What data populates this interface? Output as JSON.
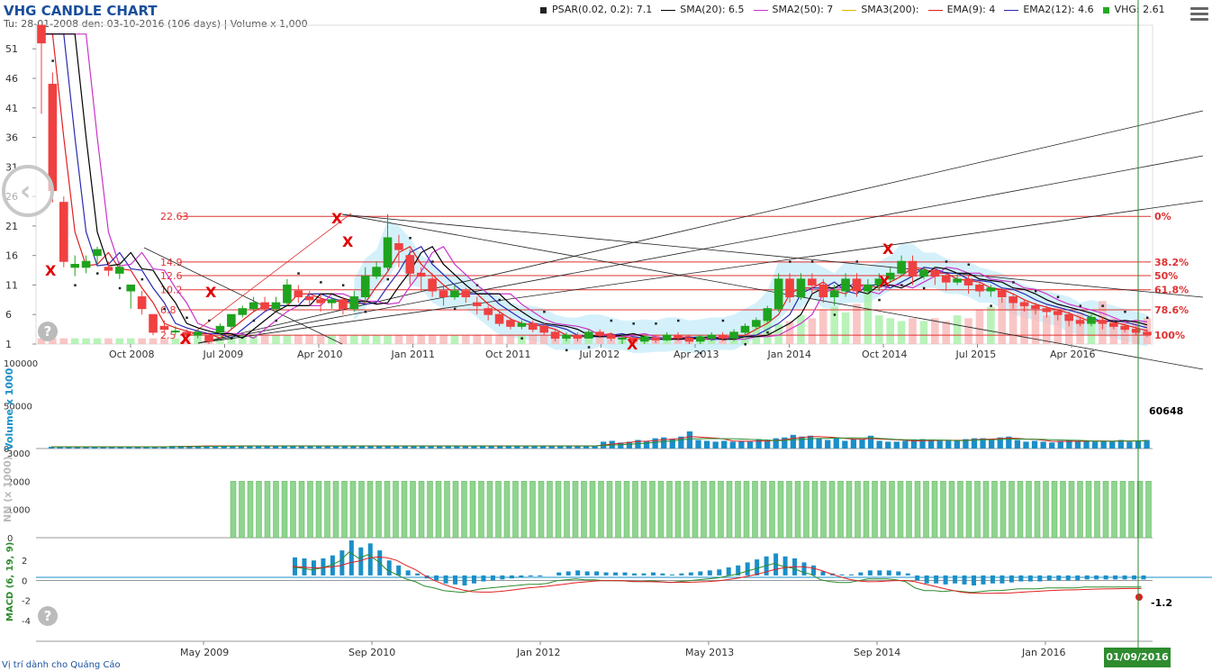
{
  "title": "VHG CANDLE CHART",
  "subtitle": "Tu: 28-01-2008 den: 03-10-2016 (106 days) | Volume x 1,000",
  "legend": [
    {
      "label": "PSAR(0.02, 0.2): 7.1",
      "color": "#222222",
      "kind": "square"
    },
    {
      "label": "SMA(20): 6.5",
      "color": "#000000",
      "kind": "line"
    },
    {
      "label": "SMA2(50): 7",
      "color": "#cc33cc",
      "kind": "line"
    },
    {
      "label": "SMA3(200):",
      "color": "#e6b800",
      "kind": "line"
    },
    {
      "label": "EMA(9): 4",
      "color": "#e02020",
      "kind": "line"
    },
    {
      "label": "EMA2(12): 4.6",
      "color": "#2a2ab0",
      "kind": "line"
    },
    {
      "label": "VHG: 2.61",
      "color": "#22aa22",
      "kind": "square"
    }
  ],
  "footer": "Vị trí dành cho Quảng Cáo",
  "date_badge": "01/09/2016",
  "colors": {
    "up": "#1fa31f",
    "down": "#f04040",
    "volume": "#1a8fc8",
    "foreign": "#8fd48f",
    "ichimoku": "#b8e8f8",
    "fib": "#e03030"
  },
  "chart_data": [
    {
      "type": "candlestick",
      "name": "price",
      "ylim": [
        1,
        55
      ],
      "yticks": [
        "1",
        "6",
        "11",
        "16",
        "21",
        "26",
        "31",
        "36",
        "41",
        "46",
        "51"
      ],
      "xtick_labels": [
        "Oct 2008",
        "Jul 2009",
        "Apr 2010",
        "Jan 2011",
        "Oct 2011",
        "Jul 2012",
        "Apr 2013",
        "Jan 2014",
        "Oct 2014",
        "Jul 2015",
        "Apr 2016"
      ],
      "candles": [
        [
          55,
          52,
          55,
          40
        ],
        [
          45,
          27,
          47,
          25
        ],
        [
          25,
          15,
          26,
          14
        ],
        [
          14,
          14.5,
          16,
          12.5
        ],
        [
          14,
          15,
          16,
          13
        ],
        [
          16,
          17,
          17.5,
          14.5
        ],
        [
          14,
          13.5,
          15,
          12.5
        ],
        [
          13,
          14,
          15,
          12
        ],
        [
          10,
          11,
          11,
          7
        ],
        [
          9,
          7,
          10,
          6
        ],
        [
          6,
          3,
          6,
          2.5
        ],
        [
          4,
          3.5,
          5,
          3
        ],
        [
          3.2,
          3.2,
          4,
          2.5
        ],
        [
          3,
          2.5,
          3.5,
          1.5
        ],
        [
          2.5,
          3,
          3.5,
          2
        ],
        [
          2.5,
          1.5,
          3,
          1
        ],
        [
          3,
          4,
          4.5,
          2.5
        ],
        [
          4,
          6,
          6,
          3.5
        ],
        [
          6,
          7,
          7.5,
          5.5
        ],
        [
          7,
          8,
          9,
          6.5
        ],
        [
          8,
          7,
          9,
          6.5
        ],
        [
          7,
          8,
          9,
          6.5
        ],
        [
          8,
          11,
          12,
          7.5
        ],
        [
          10,
          9,
          11,
          8
        ],
        [
          9,
          8.5,
          10,
          7.5
        ],
        [
          8.5,
          8,
          9.5,
          6.5
        ],
        [
          8,
          8.5,
          9,
          7
        ],
        [
          8.5,
          7,
          9,
          6
        ],
        [
          7,
          9,
          10,
          6.5
        ],
        [
          9,
          12.5,
          14,
          8
        ],
        [
          12.5,
          14,
          15,
          12
        ],
        [
          14,
          19,
          23,
          13.5
        ],
        [
          18,
          17,
          19.5,
          14
        ],
        [
          16,
          13,
          17,
          11
        ],
        [
          13,
          12.5,
          14,
          10
        ],
        [
          12,
          10,
          13,
          9
        ],
        [
          10,
          9,
          11,
          7.5
        ],
        [
          9,
          10,
          11,
          8.5
        ],
        [
          10,
          9,
          10.5,
          8
        ],
        [
          8,
          7.5,
          9,
          6
        ],
        [
          7,
          6,
          7.5,
          5
        ],
        [
          6,
          4.5,
          6.5,
          4
        ],
        [
          5,
          4,
          5.5,
          3.5
        ],
        [
          4,
          4.5,
          5,
          3.5
        ],
        [
          4.5,
          3.5,
          5,
          3
        ],
        [
          4,
          3,
          4.5,
          2.5
        ],
        [
          3,
          2,
          3.5,
          1.5
        ],
        [
          2,
          2.5,
          3,
          1.5
        ],
        [
          2.5,
          2,
          3,
          1.5
        ],
        [
          2,
          3,
          3.5,
          2
        ],
        [
          3,
          2.5,
          3.5,
          2
        ],
        [
          2.5,
          2,
          3,
          1.5
        ],
        [
          2,
          2,
          2.5,
          1
        ],
        [
          2,
          1.5,
          2.5,
          1
        ],
        [
          1.5,
          2.2,
          2.5,
          1
        ],
        [
          2,
          1.7,
          2.5,
          1.2
        ],
        [
          1.7,
          2.5,
          3,
          1.5
        ],
        [
          2.5,
          2,
          3,
          1.5
        ],
        [
          2,
          1.5,
          2.5,
          1
        ],
        [
          1.5,
          2.2,
          2.5,
          1
        ],
        [
          2,
          2.5,
          3,
          1.5
        ],
        [
          2.5,
          2,
          3,
          1.5
        ],
        [
          2,
          3,
          3.5,
          1.5
        ],
        [
          3,
          4,
          4.5,
          2.5
        ],
        [
          4,
          5,
          5.5,
          3.5
        ],
        [
          5,
          7,
          7.5,
          4.5
        ],
        [
          7,
          12,
          13,
          6.5
        ],
        [
          12,
          9,
          13,
          8
        ],
        [
          9,
          12,
          13,
          8.5
        ],
        [
          12,
          11,
          13,
          9.5
        ],
        [
          11,
          9,
          12,
          8
        ],
        [
          9,
          10,
          11,
          7.5
        ],
        [
          10,
          12,
          13,
          9
        ],
        [
          12,
          10,
          13,
          9
        ],
        [
          10,
          11,
          12,
          9.5
        ],
        [
          11,
          12,
          13,
          10
        ],
        [
          12,
          13,
          14,
          11.5
        ],
        [
          13,
          15,
          16,
          12.5
        ],
        [
          15,
          12.5,
          16,
          11
        ],
        [
          12.5,
          13.5,
          14,
          12
        ],
        [
          13.5,
          12.5,
          14,
          11
        ],
        [
          12.5,
          11.5,
          13,
          10
        ],
        [
          11.5,
          12,
          13,
          11
        ],
        [
          12,
          11,
          12.5,
          9.5
        ],
        [
          11,
          10,
          11.5,
          9
        ],
        [
          10,
          10.5,
          11,
          9
        ],
        [
          10,
          9,
          10.5,
          8
        ],
        [
          9,
          8,
          9.5,
          7
        ],
        [
          8,
          7.5,
          8.5,
          6.5
        ],
        [
          7.5,
          7,
          8,
          6
        ],
        [
          7,
          6.5,
          7.5,
          5.5
        ],
        [
          6.5,
          6,
          7,
          5
        ],
        [
          6,
          5,
          6.5,
          4
        ],
        [
          5,
          4.5,
          5.5,
          4
        ],
        [
          4.5,
          5.5,
          6,
          4
        ],
        [
          5,
          4.5,
          5.5,
          3.5
        ],
        [
          4.5,
          4,
          5,
          3.5
        ],
        [
          4,
          3.5,
          4.5,
          3
        ],
        [
          3.5,
          3,
          4,
          2.5
        ],
        [
          3,
          2.6,
          3.5,
          2.2
        ]
      ],
      "fib_levels": [
        {
          "left_label": "22.63",
          "right_label": "0%",
          "value": 22.63
        },
        {
          "left_label": "14.9",
          "right_label": "38.2%",
          "value": 14.9
        },
        {
          "left_label": "12.6",
          "right_label": "50%",
          "value": 12.6
        },
        {
          "left_label": "10.2",
          "right_label": "61.8%",
          "value": 10.2
        },
        {
          "left_label": "6.8",
          "right_label": "78.6%",
          "value": 6.8
        },
        {
          "left_label": "2.5",
          "right_label": "100%",
          "value": 2.5
        }
      ]
    },
    {
      "type": "bar",
      "name": "volume",
      "ylabel": "Volume x 1000",
      "ylim": [
        0,
        100000
      ],
      "yticks": [
        "0",
        "50000",
        "100000"
      ],
      "last_value": "60648",
      "xtick_labels": [
        "May 2009",
        "Sep 2010",
        "Jan 2012",
        "May 2013",
        "Sep 2014",
        "Jan 2016"
      ],
      "values": [
        2000,
        2000,
        2000,
        2000,
        2000,
        2000,
        2000,
        2000,
        2000,
        2000,
        2000,
        2000,
        2000,
        2000,
        3000,
        3000,
        3000,
        3000,
        3000,
        3000,
        3000,
        3000,
        3000,
        3000,
        3000,
        3000,
        3000,
        3000,
        3000,
        3000,
        3000,
        3000,
        3000,
        3000,
        3000,
        3000,
        3000,
        3000,
        3000,
        3000,
        3000,
        3000,
        3000,
        3000,
        3000,
        3000,
        3000,
        3000,
        3000,
        3000,
        3000,
        3000,
        3000,
        3000,
        3000,
        3000,
        3000,
        3000,
        3000,
        3000,
        3000,
        3000,
        3000,
        3000,
        8000,
        9000,
        7000,
        8000,
        10000,
        9000,
        12000,
        13000,
        11000,
        14000,
        20000,
        10000,
        9000,
        8000,
        9000,
        8000,
        9000,
        8000,
        10000,
        9000,
        12000,
        13000,
        16000,
        14000,
        15000,
        12000,
        10000,
        13000,
        9000,
        11000,
        11000,
        15000,
        9000,
        8000,
        8000,
        9000,
        10000,
        11000,
        9000,
        9000,
        9000,
        10000,
        11000,
        12000,
        12000,
        10000,
        13000,
        14000,
        10000,
        8000,
        9000,
        8000,
        7000,
        9000,
        10000,
        8000,
        9000,
        8000,
        9000,
        9000,
        10000,
        8000,
        9000,
        10000
      ]
    },
    {
      "type": "bar",
      "name": "NN",
      "ylabel": "NN (x 1000)",
      "ylim": [
        0,
        3000
      ],
      "yticks": [
        "0",
        "1000",
        "2000",
        "3000"
      ],
      "value": 2000
    },
    {
      "type": "bar",
      "name": "MACD",
      "ylabel": "MACD (6, 19, 9)",
      "ylim": [
        -5,
        4
      ],
      "yticks": [
        "-4",
        "-2",
        "0",
        "2"
      ],
      "last_value": "-1.2",
      "last_value2": "-2",
      "histogram": [
        1.8,
        1.7,
        1.5,
        1.7,
        2,
        2.5,
        3.5,
        2.8,
        3.2,
        2.5,
        1.5,
        1,
        0.5,
        0.2,
        -0.3,
        -0.5,
        -0.8,
        -0.9,
        -1,
        -0.8,
        -0.6,
        -0.5,
        -0.4,
        -0.3,
        -0.2,
        -0.1,
        -0.1,
        0,
        0.3,
        0.4,
        0.5,
        0.4,
        0.4,
        0.3,
        0.3,
        0.3,
        0.2,
        0.2,
        0.3,
        0.2,
        0.1,
        0.2,
        0.3,
        0.4,
        0.5,
        0.6,
        0.8,
        1,
        1.3,
        1.6,
        1.9,
        2.2,
        1.9,
        1.7,
        1.3,
        1,
        0.4,
        0.2,
        0.1,
        0.1,
        0.3,
        0.5,
        0.5,
        0.5,
        0.4,
        0.2,
        -0.5,
        -0.8,
        -0.8,
        -0.9,
        -0.8,
        -0.9,
        -1,
        -0.9,
        -0.8,
        -0.8,
        -0.7,
        -0.6,
        -0.6,
        -0.6,
        -0.5,
        -0.5,
        -0.5,
        -0.5,
        -0.4,
        -0.4,
        -0.4,
        -0.4,
        -0.4,
        -0.4,
        -0.4
      ]
    }
  ]
}
